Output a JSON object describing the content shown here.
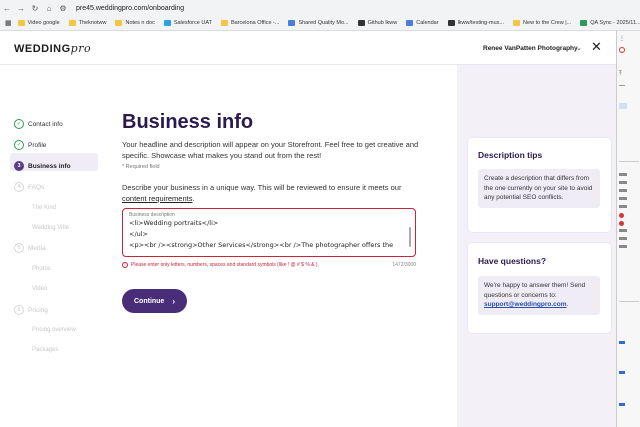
{
  "browser": {
    "url": "pre45.weddingpro.com/onboarding",
    "bookmarks": [
      {
        "label": "Video google",
        "color": "#f6c544"
      },
      {
        "label": "Theknotww",
        "color": "#f6c544"
      },
      {
        "label": "Notes n doc",
        "color": "#f6c544"
      },
      {
        "label": "Salesforce UAT",
        "color": "#2aa1e0"
      },
      {
        "label": "Barcelona Office -...",
        "color": "#f6c544"
      },
      {
        "label": "Shared Quality Mo...",
        "color": "#4a7de0"
      },
      {
        "label": "Github lkww",
        "color": "#333333"
      },
      {
        "label": "Calendar",
        "color": "#4a7de0"
      },
      {
        "label": "lkww/testing-mus...",
        "color": "#333333"
      },
      {
        "label": "New to the Crew |...",
        "color": "#f6c544"
      },
      {
        "label": "QA Sync - 2025/11...",
        "color": "#2e9a5a"
      }
    ]
  },
  "header": {
    "logo_main": "WEDDING",
    "logo_script": "pro",
    "account_name": "Renee VanPatten Photography"
  },
  "steps": [
    {
      "label": "Contact info",
      "state": "done"
    },
    {
      "label": "Profile",
      "state": "done"
    },
    {
      "label": "Business info",
      "state": "active",
      "number": "3"
    },
    {
      "label": "FAQs",
      "state": "off",
      "number": "4"
    },
    {
      "label": "The Kind",
      "state": "sub"
    },
    {
      "label": "Wedding Vibe",
      "state": "sub"
    },
    {
      "label": "Media",
      "state": "off",
      "number": "5"
    },
    {
      "label": "Photos",
      "state": "sub"
    },
    {
      "label": "Video",
      "state": "sub"
    },
    {
      "label": "Pricing",
      "state": "off",
      "number": "6"
    },
    {
      "label": "Pricing overview",
      "state": "sub"
    },
    {
      "label": "Packages",
      "state": "sub"
    }
  ],
  "main": {
    "title": "Business info",
    "intro": "Your headline and description will appear on your Storefront. Feel free to get creative and specific. Showcase what makes you stand out from the rest!",
    "required_note": "* Required field",
    "prompt": "Describe your business in a unique way. This will be reviewed to ensure it meets our",
    "prompt_link": "content requirements",
    "prompt_end": ".",
    "textarea_label": "Business description",
    "textarea_lines": [
      "<li>Wedding portraits</li>",
      "</ul>",
      "<p><br /><strong>Other Services</strong><br />The photographer offers the"
    ],
    "error_text": "Please enter only letters, numbers, spaces and standard symbols (like ! @ # $ % & ).",
    "char_count": "1472/3000",
    "continue_label": "Continue"
  },
  "tips": {
    "title": "Description tips",
    "body": "Create a description that differs from the one currently on your site to avoid any potential SEO conflicts."
  },
  "questions": {
    "title": "Have questions?",
    "body": "We're happy to answer them! Send questions or concerns to:",
    "email": "support@weddingpro.com",
    "email_suffix": "."
  },
  "colors": {
    "brand_purple": "#4a2d78",
    "title_purple": "#2c1a4d",
    "error_red": "#c8253a",
    "done_green": "#2e9a5a",
    "panel_bg": "#f3f0f8"
  }
}
